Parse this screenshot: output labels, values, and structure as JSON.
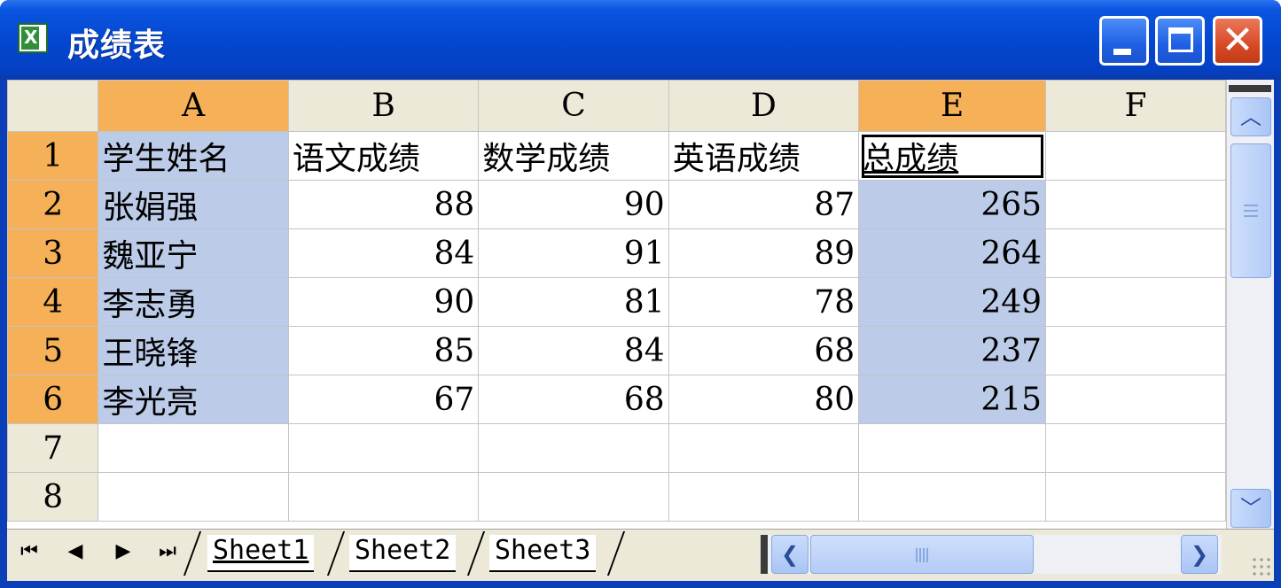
{
  "window": {
    "title": "成绩表",
    "icon": "excel-icon"
  },
  "controls": {
    "minimize_icon": "minimize-icon",
    "maximize_icon": "maximize-icon",
    "close_icon": "close-icon"
  },
  "columns": [
    "A",
    "B",
    "C",
    "D",
    "E",
    "F"
  ],
  "highlighted_columns": [
    "A",
    "E"
  ],
  "rows": [
    {
      "num": "1",
      "cells": [
        "学生姓名",
        "语文成绩",
        "数学成绩",
        "英语成绩",
        "总成绩",
        ""
      ]
    },
    {
      "num": "2",
      "cells": [
        "张娟强",
        "88",
        "90",
        "87",
        "265",
        ""
      ]
    },
    {
      "num": "3",
      "cells": [
        "魏亚宁",
        "84",
        "91",
        "89",
        "264",
        ""
      ]
    },
    {
      "num": "4",
      "cells": [
        "李志勇",
        "90",
        "81",
        "78",
        "249",
        ""
      ]
    },
    {
      "num": "5",
      "cells": [
        "王晓锋",
        "85",
        "84",
        "68",
        "237",
        ""
      ]
    },
    {
      "num": "6",
      "cells": [
        "李光亮",
        "67",
        "68",
        "80",
        "215",
        ""
      ]
    },
    {
      "num": "7",
      "cells": [
        "",
        "",
        "",
        "",
        "",
        ""
      ]
    },
    {
      "num": "8",
      "cells": [
        "",
        "",
        "",
        "",
        "",
        ""
      ]
    }
  ],
  "sheets": {
    "tab1": "Sheet1",
    "tab2": "Sheet2",
    "tab3": "Sheet3",
    "active": "Sheet1"
  },
  "colors": {
    "titlebar": "#0447d0",
    "header_highlight": "#f5b058",
    "selection": "#bccbe8",
    "header_bg": "#ece9d8"
  }
}
